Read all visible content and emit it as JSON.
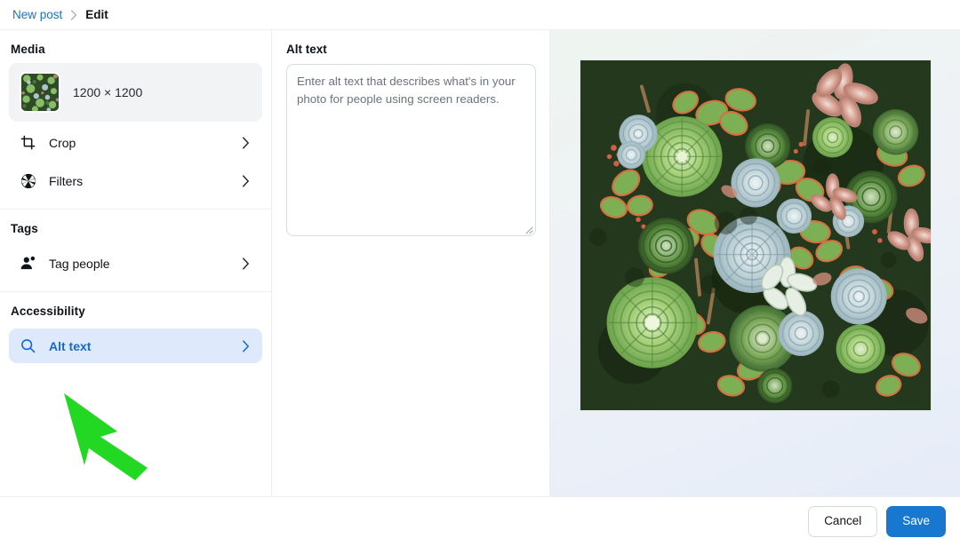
{
  "breadcrumb": {
    "parent": "New post",
    "separator": "›",
    "current": "Edit"
  },
  "sidebar": {
    "sections": [
      {
        "title": "Media",
        "media": {
          "dimensions": "1200 × 1200",
          "thumbnail_icon": "succulent-photo-thumbnail"
        },
        "rows": [
          {
            "label": "Crop",
            "icon": "crop-icon",
            "chevron": "chevron-right-icon",
            "selected": false
          },
          {
            "label": "Filters",
            "icon": "aperture-icon",
            "chevron": "chevron-right-icon",
            "selected": false
          }
        ]
      },
      {
        "title": "Tags",
        "rows": [
          {
            "label": "Tag people",
            "icon": "person-add-icon",
            "chevron": "chevron-right-icon",
            "selected": false
          }
        ]
      },
      {
        "title": "Accessibility",
        "rows": [
          {
            "label": "Alt text",
            "icon": "search-icon",
            "chevron": "chevron-right-icon",
            "selected": true
          }
        ]
      }
    ]
  },
  "alt_text_panel": {
    "title": "Alt text",
    "value": "",
    "placeholder": "Enter alt text that describes what's in your photo for people using screen readers.",
    "resize_handle": "resize-grip-icon"
  },
  "preview": {
    "image_alt": "Dense wall of succulents — green rosettes, pale blue-grey echeverias and red-tipped jade plants",
    "image_icon": "succulent-photo-preview"
  },
  "footer": {
    "cancel_label": "Cancel",
    "save_label": "Save"
  },
  "annotation": {
    "arrow_icon": "green-arrow-pointing-up-left",
    "arrow_color": "#22d822"
  },
  "colors": {
    "accent_blue": "#1878cf",
    "link_blue": "#1a73c7",
    "selected_row_bg": "#deeafc",
    "selected_row_text": "#1567d3",
    "panel_border": "#eceef0",
    "media_card_bg": "#f2f3f5",
    "annotation_green": "#22d822"
  }
}
